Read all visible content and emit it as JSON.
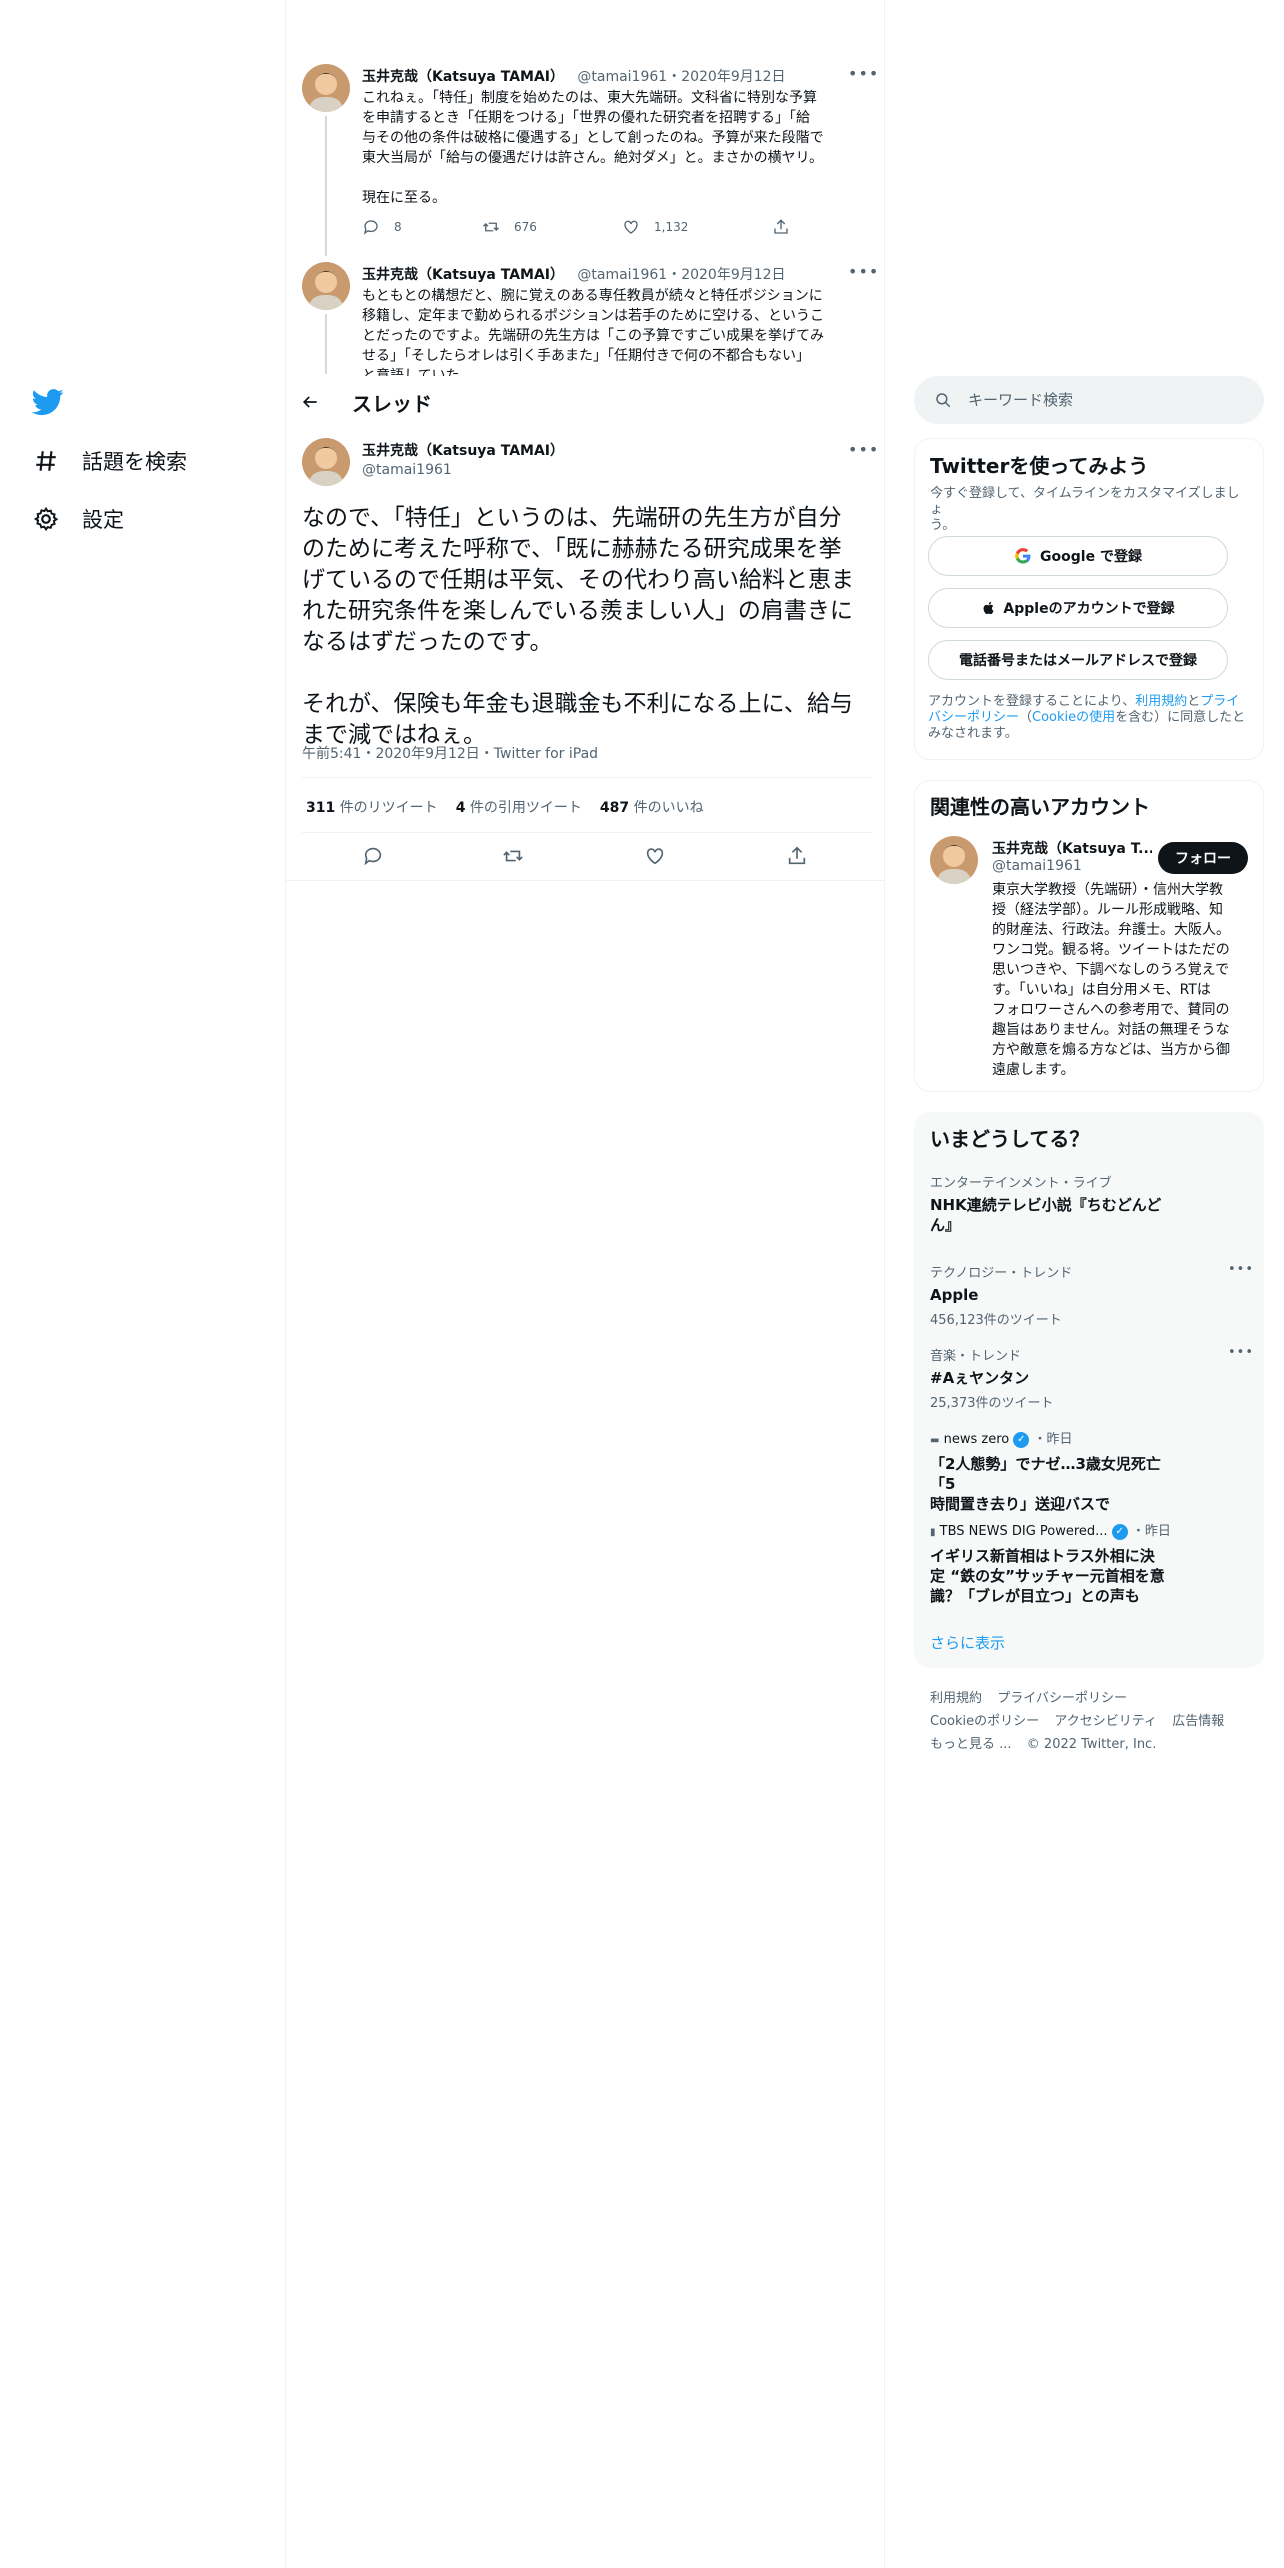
{
  "nav": {
    "explore_label": "話題を検索",
    "settings_label": "設定"
  },
  "thread": {
    "header_title": "スレッド",
    "prev_tweets": [
      {
        "author": "玉井克哉（Katsuya TAMAI）",
        "handle": "@tamai1961",
        "date": "2020年9月12日",
        "text_lines": [
          "これねぇ。「特任」制度を始めたのは、東大先端研。文科省に特別な予算",
          "を申請するとき「任期をつける」「世界の優れた研究者を招聘する」「給",
          "与その他の条件は破格に優遇する」として創ったのね。予算が来た段階で",
          "東大当局が「給与の優遇だけは許さん。絶対ダメ」と。まさかの横ヤリ。",
          "",
          "現在に至る。"
        ],
        "replies": "8",
        "retweets": "676",
        "likes": "1,132"
      },
      {
        "author": "玉井克哉（Katsuya TAMAI）",
        "handle": "@tamai1961",
        "date": "2020年9月12日",
        "text_lines": [
          "もともとの構想だと、腕に覚えのある専任教員が続々と特任ポジションに",
          "移籍し、定年まで勤められるポジションは若手のために空ける、というこ",
          "とだったのですよ。先端研の先生方は「この予算ですごい成果を挙げてみ",
          "せる」「そしたらオレは引く手あまた」「任期付きで何の不都合もない」",
          "と意語していた"
        ]
      }
    ],
    "main_tweet": {
      "author": "玉井克哉（Katsuya TAMAI）",
      "handle": "@tamai1961",
      "text_lines": [
        "なので、「特任」というのは、先端研の先生方が自分",
        "のために考えた呼称で、「既に赫赫たる研究成果を挙",
        "げているので任期は平気、その代わり高い給料と恵ま",
        "れた研究条件を楽しんでいる羨ましい人」の肩書きに",
        "なるはずだったのです。",
        "",
        "それが、保険も年金も退職金も不利になる上に、給与",
        "まで減ではねぇ。"
      ],
      "timestamp": "午前5:41・2020年9月12日・Twitter for iPad",
      "retweets_count": "311",
      "retweets_label": "件のリツイート",
      "quotes_count": "4",
      "quotes_label": "件の引用ツイート",
      "likes_count": "487",
      "likes_label": "件のいいね"
    }
  },
  "search": {
    "placeholder": "キーワード検索"
  },
  "signup": {
    "title": "Twitterを使ってみよう",
    "subtitle_lines": [
      "今すぐ登録して、タイムラインをカスタマイズしましょ",
      "う。"
    ],
    "google_label": "Google で登録",
    "apple_label": "Appleのアカウントで登録",
    "phone_label": "電話番号またはメールアドレスで登録",
    "terms_prefix": "アカウントを登録することにより、",
    "terms_link": "利用規約",
    "terms_and": "と",
    "privacy_link": "プライバシーポリシー",
    "cookie_open": "（",
    "cookie_link": "Cookieの使用",
    "terms_suffix": "を含む）に同意したとみなされます。"
  },
  "related": {
    "title": "関連性の高いアカウント",
    "name": "玉井克哉（Katsuya T...",
    "handle": "@tamai1961",
    "follow_label": "フォロー",
    "bio_lines": [
      "東京大学教授（先端研）・信州大学教",
      "授（経法学部）。ルール形成戦略、知",
      "的財産法、行政法。弁護士。大阪人。",
      "ワンコ党。観る将。ツイートはただの",
      "思いつきや、下調べなしのうろ覚えで",
      "す。「いいね」は自分用メモ、RTは",
      "フォロワーさんへの参考用で、賛同の",
      "趣旨はありません。対話の無理そうな",
      "方や敵意を煽る方などは、当方から御",
      "遠慮します。"
    ]
  },
  "trends": {
    "title": "いまどうしてる？",
    "items": [
      {
        "category": "エンターテインメント・ライブ",
        "name_lines": [
          "NHK連続テレビ小説『ちむどんど",
          "ん』"
        ],
        "count": ""
      },
      {
        "category": "テクノロジー・トレンド",
        "name_lines": [
          "Apple"
        ],
        "count": "456,123件のツイート"
      },
      {
        "category": "音楽・トレンド",
        "name_lines": [
          "#Aぇヤンタン"
        ],
        "count": "25,373件のツイート"
      }
    ],
    "news": [
      {
        "source": "news zero",
        "when": "・昨日",
        "headline_lines": [
          "「2人態勢」でナゼ…3歳女児死亡「5",
          "時間置き去り」送迎バスで"
        ]
      },
      {
        "source": "TBS NEWS DIG Powered...",
        "when": "・昨日",
        "headline_lines": [
          "イギリス新首相はトラス外相に決",
          "定 “鉄の女”サッチャー元首相を意",
          "識？「ブレが目立つ」との声も"
        ]
      }
    ],
    "show_more": "さらに表示"
  },
  "footer": {
    "terms": "利用規約",
    "privacy": "プライバシーポリシー",
    "cookie": "Cookieのポリシー",
    "accessibility": "アクセシビリティ",
    "ads": "広告情報",
    "more": "もっと見る ...",
    "copyright": "© 2022 Twitter, Inc."
  },
  "colors": {
    "accent": "#1d9bf0",
    "text": "#0f1419",
    "secondary": "#536471",
    "border": "#eff3f4"
  }
}
